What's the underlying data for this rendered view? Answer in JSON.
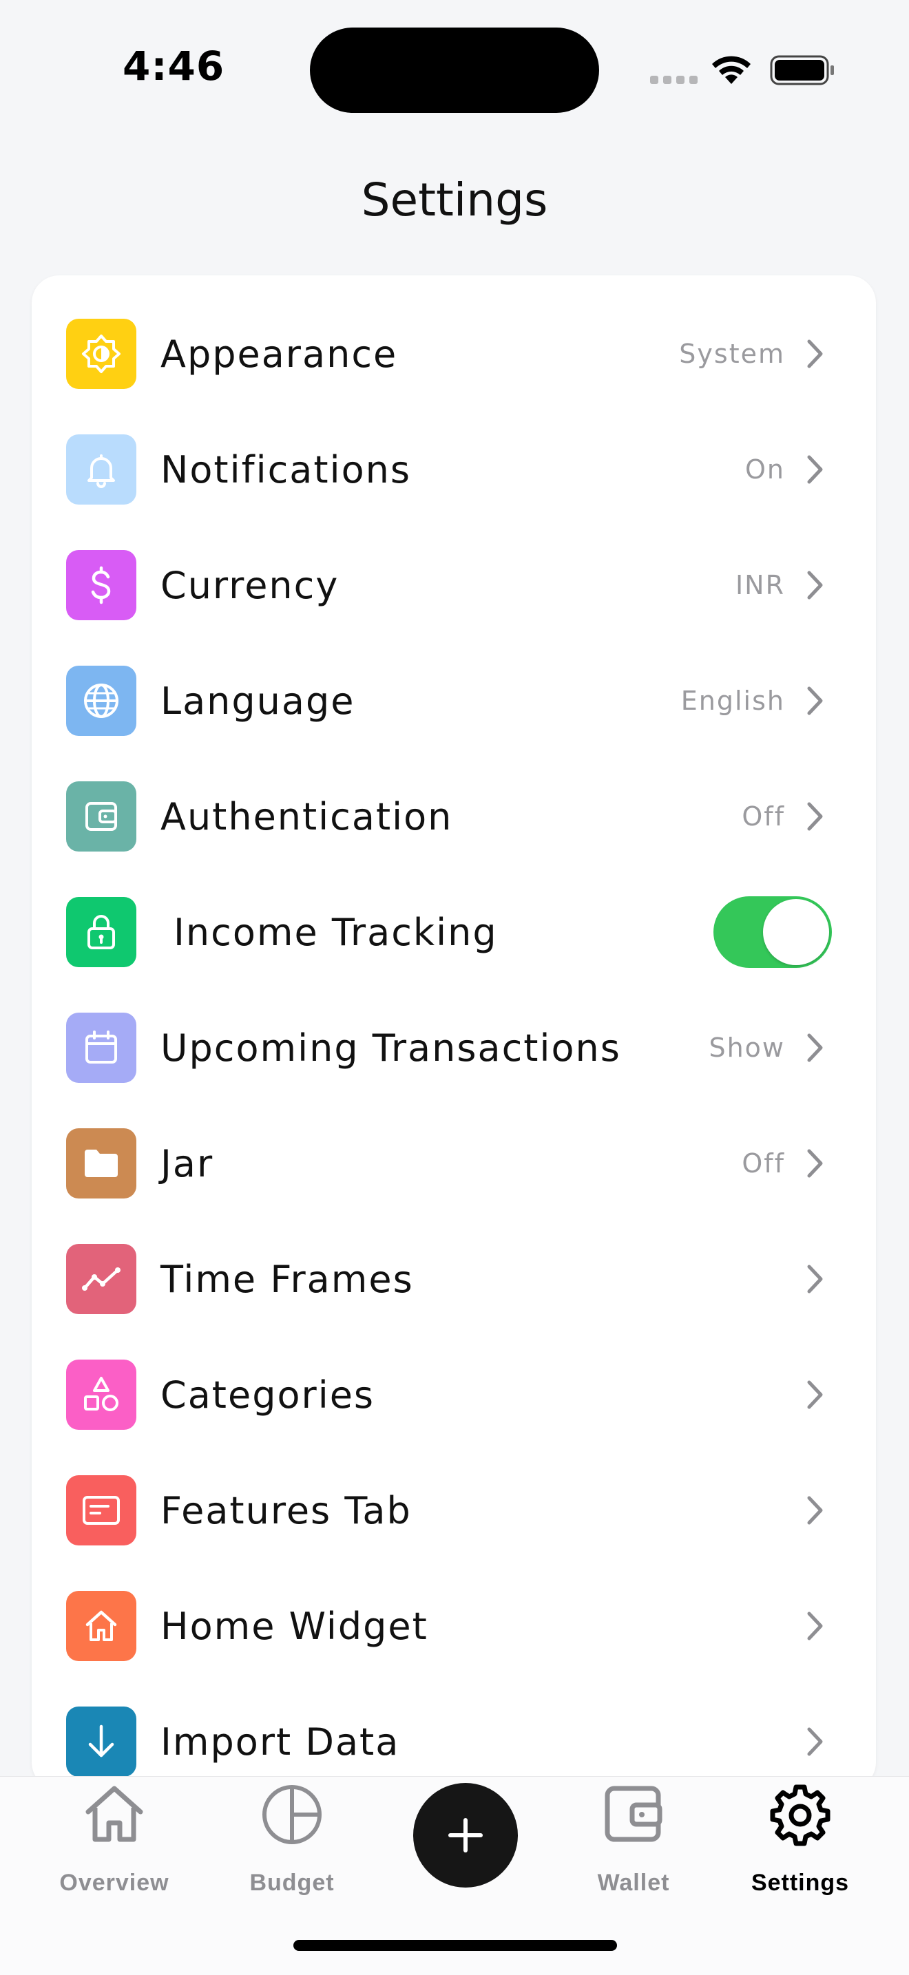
{
  "status_bar": {
    "time": "4:46"
  },
  "page": {
    "title": "Settings"
  },
  "colors": {
    "appearance": "#FFD012",
    "notifications": "#B9DCFD",
    "currency": "#D85CF5",
    "language": "#7DB6F1",
    "authentication": "#6AB3A7",
    "income_tracking": "#0FC86F",
    "upcoming_transactions": "#A5ABF6",
    "jar": "#CC8A52",
    "time_frames": "#E2637A",
    "categories": "#FB5FC6",
    "features_tab": "#F95F5E",
    "home_widget": "#FD7549",
    "import_data": "#1A87B5",
    "toggle_on": "#34C759"
  },
  "settings": {
    "appearance": {
      "label": "Appearance",
      "value": "System",
      "icon": "sun-icon"
    },
    "notifications": {
      "label": "Notifications",
      "value": "On",
      "icon": "bell-icon"
    },
    "currency": {
      "label": "Currency",
      "value": "INR",
      "icon": "dollar-icon"
    },
    "language": {
      "label": "Language",
      "value": "English",
      "icon": "globe-icon"
    },
    "authentication": {
      "label": "Authentication",
      "value": "Off",
      "icon": "wallet-icon"
    },
    "income_tracking": {
      "label": "Income Tracking",
      "enabled": true,
      "icon": "lock-icon"
    },
    "upcoming_transactions": {
      "label": "Upcoming Transactions",
      "value": "Show",
      "icon": "calendar-icon"
    },
    "jar": {
      "label": "Jar",
      "value": "Off",
      "icon": "folder-icon"
    },
    "time_frames": {
      "label": "Time Frames",
      "icon": "trend-line-icon"
    },
    "categories": {
      "label": "Categories",
      "icon": "shapes-icon"
    },
    "features_tab": {
      "label": "Features Tab",
      "icon": "tab-card-icon"
    },
    "home_widget": {
      "label": "Home Widget",
      "icon": "home-icon"
    },
    "import_data": {
      "label": "Import Data",
      "icon": "arrow-down-icon"
    }
  },
  "tabbar": {
    "overview": "Overview",
    "budget": "Budget",
    "wallet": "Wallet",
    "settings": "Settings",
    "active": "settings"
  }
}
